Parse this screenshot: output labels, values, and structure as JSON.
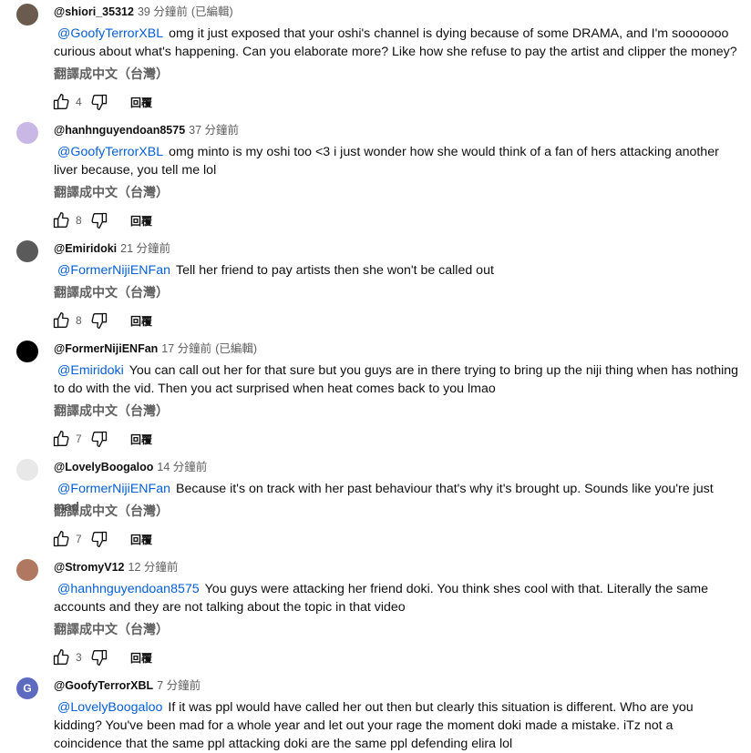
{
  "comments": [
    {
      "author": "@shiori_35312",
      "time": "39 分鐘前",
      "edited": "(已編輯)",
      "mention": "@GoofyTerrorXBL",
      "text": "omg it just exposed that your oshi's channel  is dying because of some DRAMA, and I'm sooooooo curious about what's happening. Can you elaborate more? Like how she refuse to pay the artist and clipper the money?",
      "translate": "翻譯成中文（台灣）",
      "likes": "4",
      "reply": "回覆",
      "avatar_color": "#6b5a4e"
    },
    {
      "author": "@hanhnguyendoan8575",
      "time": "37 分鐘前",
      "edited": "",
      "mention": "@GoofyTerrorXBL",
      "text": "omg minto is my oshi too <3 i just wonder how she would think of a fan of hers attacking another liver because, you tell me lol",
      "translate": "翻譯成中文（台灣）",
      "likes": "8",
      "reply": "回覆",
      "avatar_color": "#c9b8e6"
    },
    {
      "author": "@Emiridoki",
      "time": "21 分鐘前",
      "edited": "",
      "mention": "@FormerNijiENFan",
      "text": "Tell her friend to pay artists then she won't be called out",
      "translate": "翻譯成中文（台灣）",
      "likes": "8",
      "reply": "回覆",
      "avatar_color": "#5a5a5a"
    },
    {
      "author": "@FormerNijiENFan",
      "time": "17 分鐘前",
      "edited": "(已編輯)",
      "mention": "@Emiridoki",
      "text": "You can call out her for that sure but you guys are in there trying to bring up the niji thing when has nothing to do with the vid. Then you act surprised when heat comes back to you lmao",
      "translate": "翻譯成中文（台灣）",
      "likes": "7",
      "reply": "回覆",
      "avatar_color": "#000000"
    },
    {
      "author": "@LovelyBoogaloo",
      "time": "14 分鐘前",
      "edited": "",
      "mention": "@FormerNijiENFan",
      "text": "Because it's on track with her past behaviour that's why it's brought up.  Sounds like you're just mad",
      "translate": "翻譯成中文（台灣）",
      "likes": "7",
      "reply": "回覆",
      "avatar_color": "#e8e8e8"
    },
    {
      "author": "@StromyV12",
      "time": "12 分鐘前",
      "edited": "",
      "mention": "@hanhnguyendoan8575",
      "text": "You guys were attacking her friend doki. You think shes cool with that. Literally the same accounts and they are not talking about the topic in that video",
      "translate": "翻譯成中文（台灣）",
      "likes": "3",
      "reply": "回覆",
      "avatar_color": "#b07860"
    },
    {
      "author": "@GoofyTerrorXBL",
      "time": "7 分鐘前",
      "edited": "",
      "mention": "@LovelyBoogaloo",
      "text": "If it was ppl would have called her out then but clearly this situation is different. Who are you kidding? You've been mad for a whole year and let out your rage the moment doki made a mistake. iTz not a coincidence that the same ppl attacking doki are the same ppl defending elira lol",
      "translate": "",
      "likes": "",
      "reply": "",
      "avatar_color": "#5c6bc0",
      "avatar_letter": "G"
    }
  ]
}
